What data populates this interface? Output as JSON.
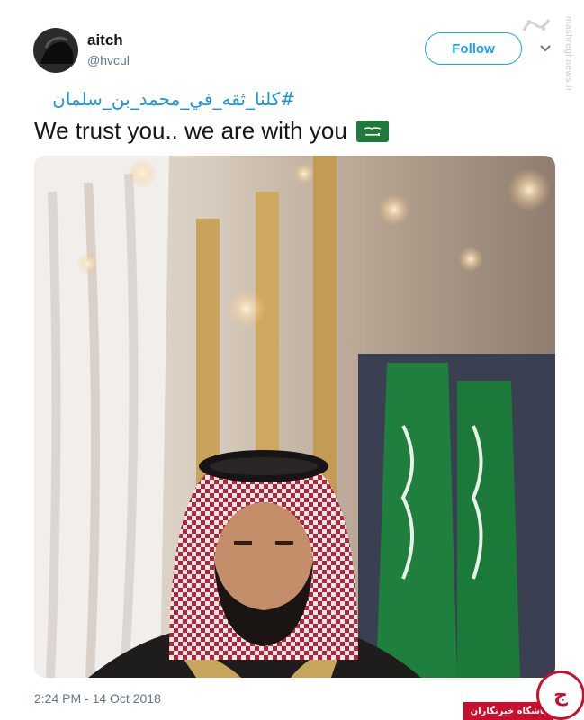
{
  "user": {
    "display_name": "aitch",
    "handle": "@hvcul"
  },
  "follow_label": "Follow",
  "tweet": {
    "hashtag": "#كلنا_ثقه_في_محمد_بن_سلمان",
    "text": "We trust you.. we are with you",
    "flag_emoji": "saudi-arabia-flag",
    "timestamp": "2:24 PM - 14 Oct 2018"
  },
  "watermark": {
    "site": "mashreghnews.ir",
    "badge_text": "باشگاه خبرنگاران",
    "badge_glyph": "ج"
  },
  "colors": {
    "accent": "#1da1f2",
    "link": "#1b95e0",
    "muted": "#657786",
    "badge": "#c8102e",
    "flag_green": "#1f7a3c"
  }
}
